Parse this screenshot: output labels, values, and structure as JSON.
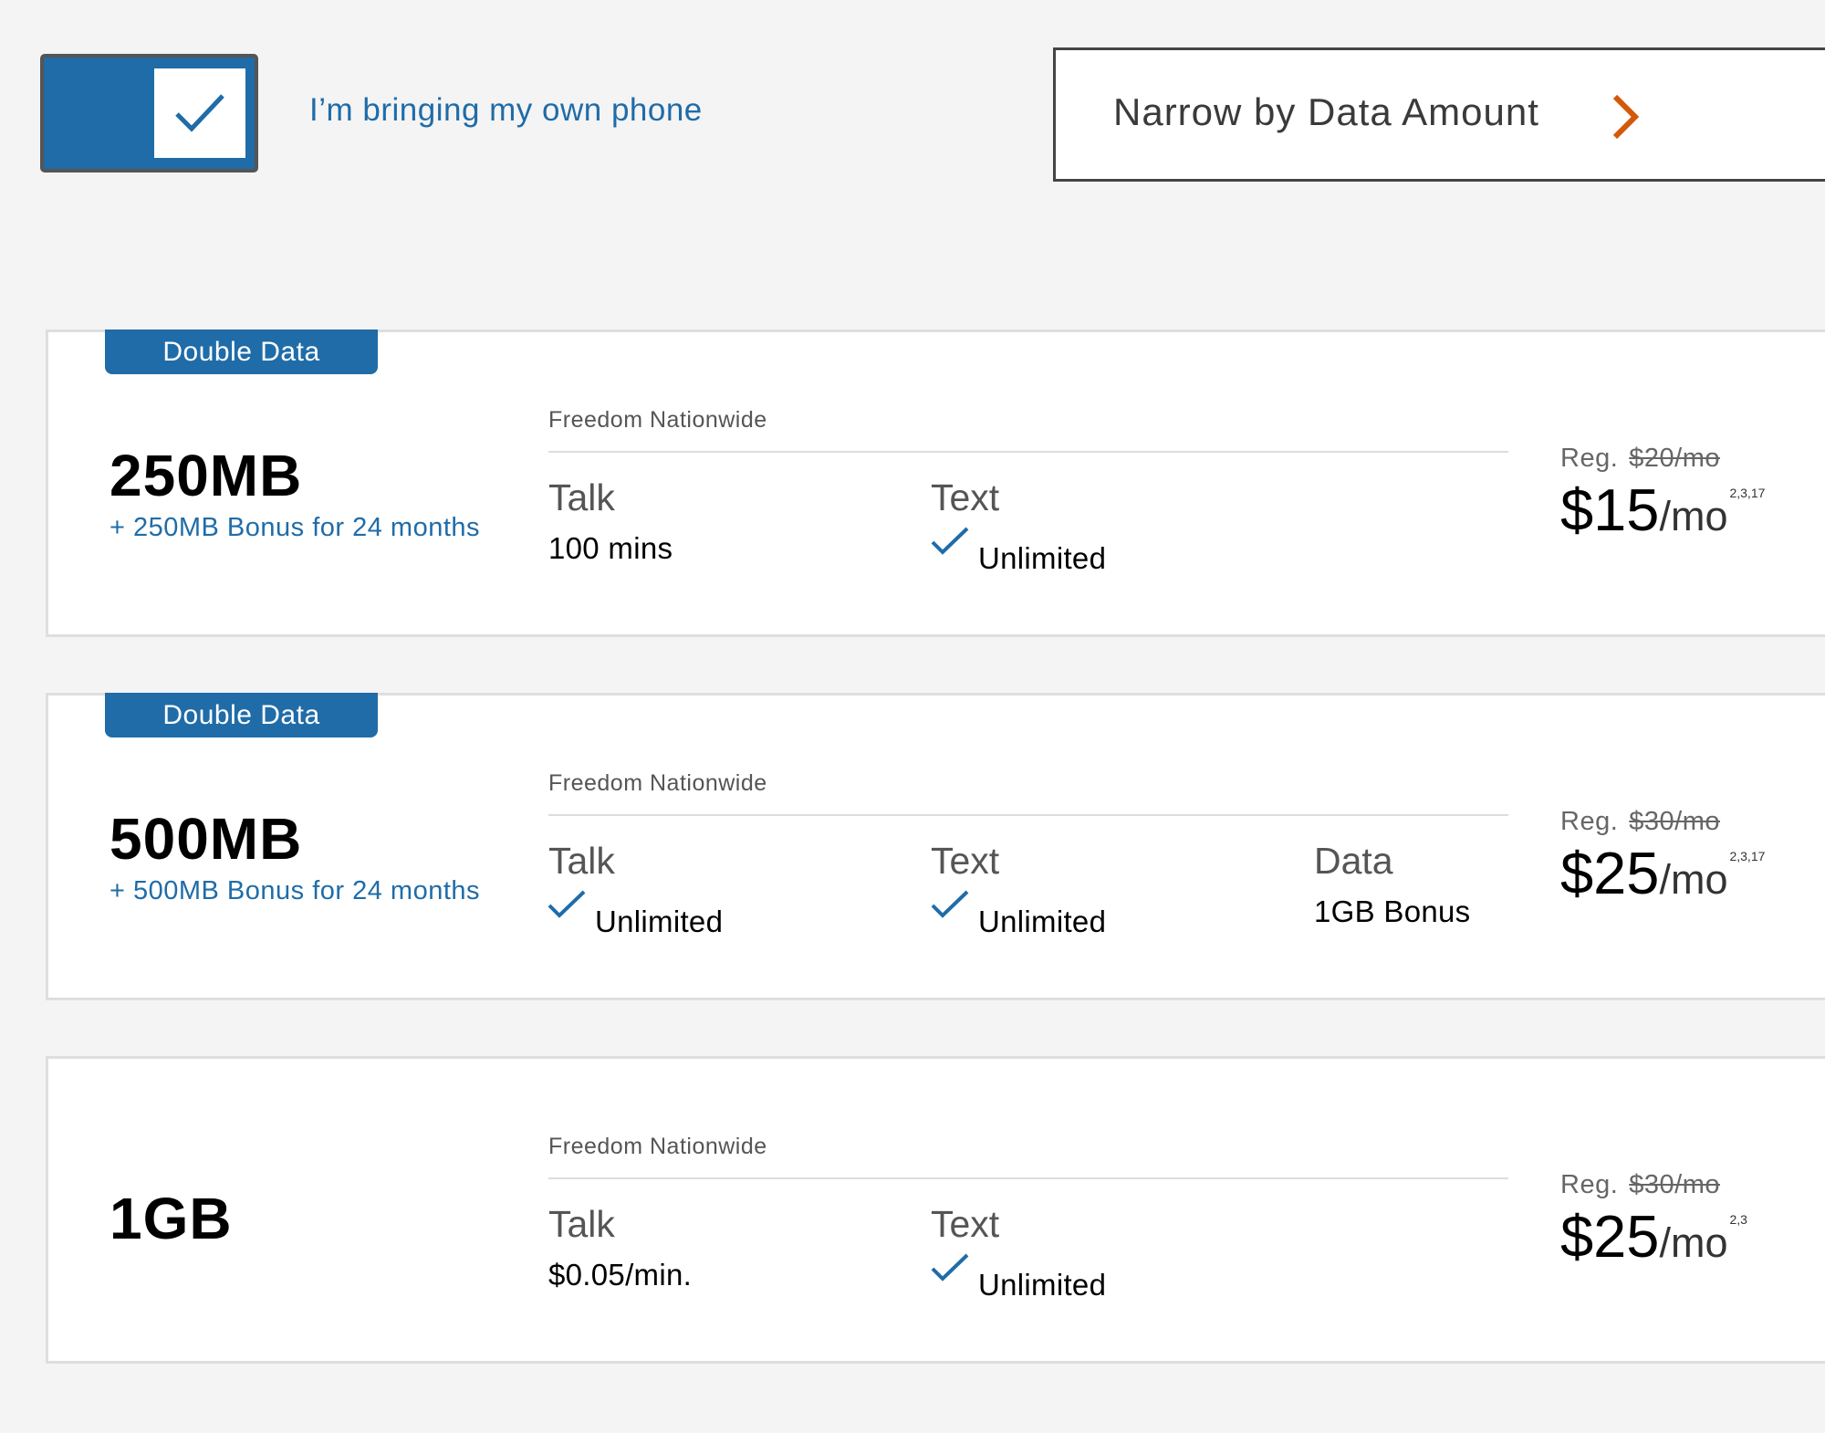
{
  "toggle": {
    "label": "I’m bringing my own phone",
    "checked": true
  },
  "narrow": {
    "label": "Narrow by Data Amount"
  },
  "colors": {
    "brand_blue": "#1f6ca8",
    "chevron_orange": "#d4580a"
  },
  "plans": [
    {
      "badge": "Double Data",
      "size": "250MB",
      "bonus": "+ 250MB Bonus for 24 months",
      "plan_name": "Freedom Nationwide",
      "talk": {
        "title": "Talk",
        "value": "100 mins"
      },
      "text": {
        "title": "Text",
        "value": "Unlimited"
      },
      "reg_label": "Reg.",
      "reg_price": "$20/mo",
      "price": "$15",
      "price_unit": "/mo",
      "footnote": "2,3,17"
    },
    {
      "badge": "Double Data",
      "size": "500MB",
      "bonus": "+ 500MB Bonus for 24 months",
      "plan_name": "Freedom Nationwide",
      "talk": {
        "title": "Talk",
        "value": "Unlimited"
      },
      "text": {
        "title": "Text",
        "value": "Unlimited"
      },
      "data": {
        "title": "Data",
        "value": "1GB Bonus"
      },
      "reg_label": "Reg.",
      "reg_price": "$30/mo",
      "price": "$25",
      "price_unit": "/mo",
      "footnote": "2,3,17"
    },
    {
      "size": "1GB",
      "plan_name": "Freedom Nationwide",
      "talk": {
        "title": "Talk",
        "value": "$0.05/min."
      },
      "text": {
        "title": "Text",
        "value": "Unlimited"
      },
      "reg_label": "Reg.",
      "reg_price": "$30/mo",
      "price": "$25",
      "price_unit": "/mo",
      "footnote": "2,3"
    }
  ]
}
